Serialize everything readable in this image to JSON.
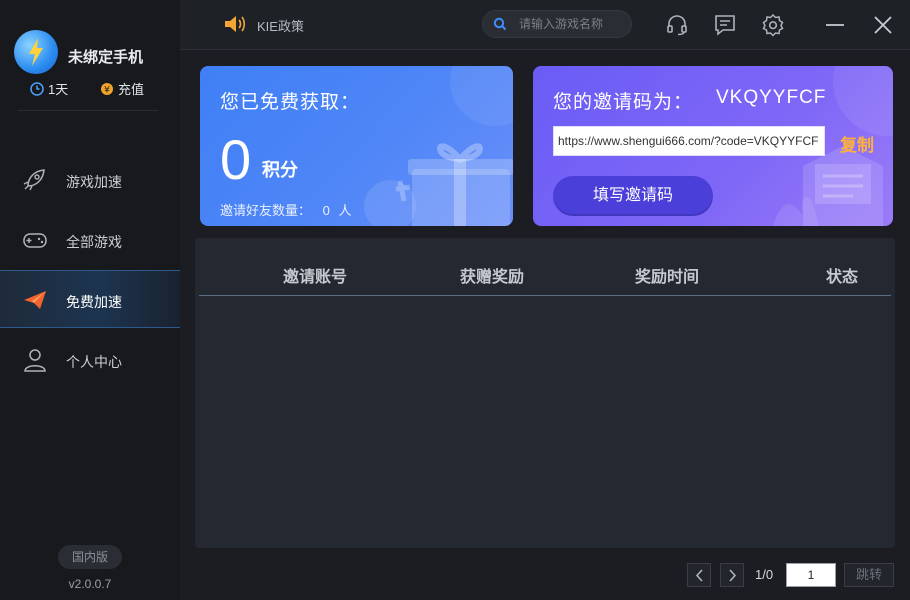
{
  "app": {
    "title": "未绑定手机",
    "days": "1天",
    "charge": "充值",
    "region": "国内版",
    "version": "v2.0.0.7"
  },
  "sidebar": {
    "items": [
      {
        "label": "游戏加速",
        "icon": "rocket-icon"
      },
      {
        "label": "全部游戏",
        "icon": "gamepad-icon"
      },
      {
        "label": "免费加速",
        "icon": "paper-plane-icon",
        "active": true
      },
      {
        "label": "个人中心",
        "icon": "user-icon"
      }
    ]
  },
  "topbar": {
    "notice": "KIE政策",
    "search_placeholder": "请输入游戏名称",
    "icons": [
      "headset-icon",
      "message-icon",
      "settings-icon",
      "minimize-icon",
      "close-icon"
    ]
  },
  "rewards": {
    "title": "您已免费获取：",
    "points": "0",
    "points_unit": "积分",
    "friends_label": "邀请好友数量：",
    "friends_count": "0",
    "friends_unit": "人"
  },
  "invite": {
    "title": "您的邀请码为：",
    "code": "VKQYYFCF",
    "url": "https://www.shengui666.com/?code=VKQYYFCF",
    "copy_label": "复制",
    "fill_button": "填写邀请码"
  },
  "table": {
    "columns": [
      "邀请账号",
      "获赠奖励",
      "奖励时间",
      "状态"
    ],
    "rows": []
  },
  "pagination": {
    "info": "1/0",
    "page_value": "1",
    "jump_label": "跳转"
  },
  "colors": {
    "accent_blue": "#3f7ff5",
    "accent_purple": "#6a5cf6",
    "copy_orange": "#ffb13b",
    "active_nav": "#1d3450"
  }
}
